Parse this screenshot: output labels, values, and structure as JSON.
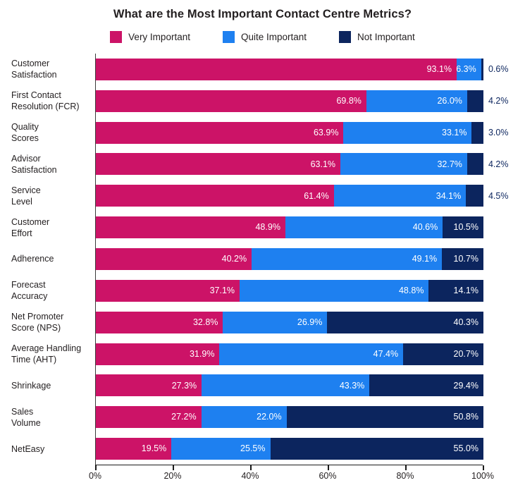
{
  "chart_data": {
    "type": "bar",
    "subtype": "horizontal-stacked-100",
    "title": "What are the Most Important Contact Centre Metrics?",
    "xlabel": "",
    "ylabel": "",
    "xlim": [
      0,
      100
    ],
    "xticks": [
      0,
      20,
      40,
      60,
      80,
      100
    ],
    "xtick_labels": [
      "0%",
      "20%",
      "40%",
      "60%",
      "80%",
      "100%"
    ],
    "grid": false,
    "legend_position": "top-center",
    "categories": [
      "Customer Satisfaction",
      "First Contact Resolution (FCR)",
      "Quality Scores",
      "Advisor Satisfaction",
      "Service Level",
      "Customer Effort",
      "Adherence",
      "Forecast Accuracy",
      "Net Promoter Score (NPS)",
      "Average Handling Time (AHT)",
      "Shrinkage",
      "Sales Volume",
      "NetEasy"
    ],
    "category_lines": [
      [
        "Customer",
        "Satisfaction"
      ],
      [
        "First Contact",
        "Resolution (FCR)"
      ],
      [
        "Quality",
        "Scores"
      ],
      [
        "Advisor",
        "Satisfaction"
      ],
      [
        "Service",
        "Level"
      ],
      [
        "Customer",
        "Effort"
      ],
      [
        "Adherence"
      ],
      [
        "Forecast",
        "Accuracy"
      ],
      [
        "Net Promoter",
        "Score (NPS)"
      ],
      [
        "Average Handling",
        "Time (AHT)"
      ],
      [
        "Shrinkage"
      ],
      [
        "Sales",
        "Volume"
      ],
      [
        "NetEasy"
      ]
    ],
    "series": [
      {
        "name": "Very Important",
        "color": "#cc1367",
        "values": [
          93.1,
          69.8,
          63.9,
          63.1,
          61.4,
          48.9,
          40.2,
          37.1,
          32.8,
          31.9,
          27.3,
          27.2,
          19.5
        ],
        "labels": [
          "93.1%",
          "69.8%",
          "63.9%",
          "63.1%",
          "61.4%",
          "48.9%",
          "40.2%",
          "37.1%",
          "32.8%",
          "31.9%",
          "27.3%",
          "27.2%",
          "19.5%"
        ]
      },
      {
        "name": "Quite Important",
        "color": "#1e80f0",
        "values": [
          6.3,
          26.0,
          33.1,
          32.7,
          34.1,
          40.6,
          49.1,
          48.8,
          26.9,
          47.4,
          43.3,
          22.0,
          25.5
        ],
        "labels": [
          "6.3%",
          "26.0%",
          "33.1%",
          "32.7%",
          "34.1%",
          "40.6%",
          "49.1%",
          "48.8%",
          "26.9%",
          "47.4%",
          "43.3%",
          "22.0%",
          "25.5%"
        ]
      },
      {
        "name": "Not Important",
        "color": "#0c255e",
        "values": [
          0.6,
          4.2,
          3.0,
          4.2,
          4.5,
          10.5,
          10.7,
          14.1,
          40.3,
          20.7,
          29.4,
          50.8,
          55.0
        ],
        "labels": [
          "0.6%",
          "4.2%",
          "3.0%",
          "4.2%",
          "4.5%",
          "10.5%",
          "10.7%",
          "14.1%",
          "40.3%",
          "20.7%",
          "29.4%",
          "50.8%",
          "55.0%"
        ],
        "label_placement": [
          "outside",
          "outside",
          "outside",
          "outside",
          "outside",
          "inside",
          "inside",
          "inside",
          "inside",
          "inside",
          "inside",
          "inside",
          "inside"
        ]
      }
    ]
  },
  "legend": {
    "items": [
      {
        "label": "Very Important",
        "color": "#cc1367"
      },
      {
        "label": "Quite Important",
        "color": "#1e80f0"
      },
      {
        "label": "Not Important",
        "color": "#0c255e"
      }
    ]
  }
}
